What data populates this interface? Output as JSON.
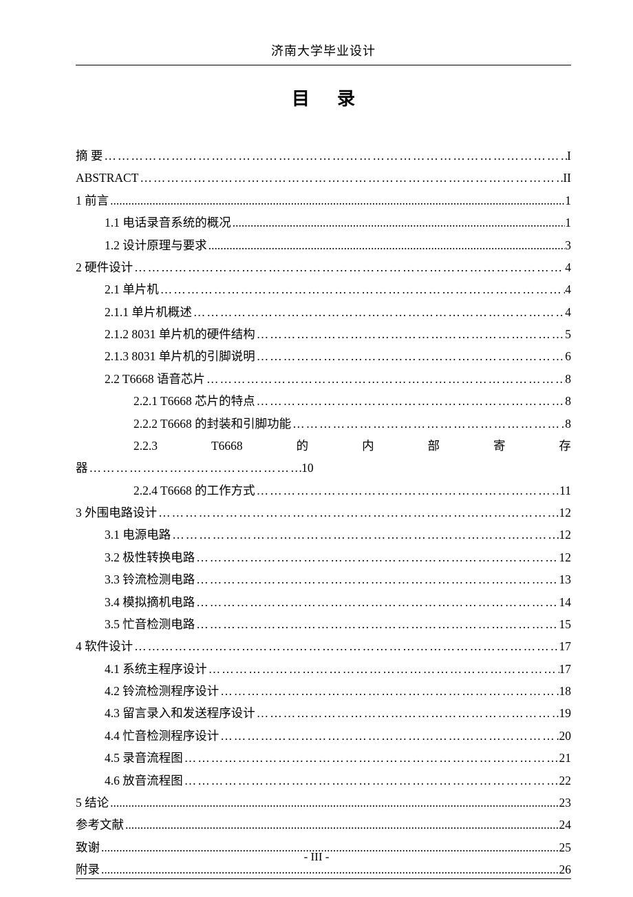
{
  "header": "济南大学毕业设计",
  "title_left": "目",
  "title_right": "录",
  "footer": "- III -",
  "toc": [
    {
      "label": "摘 要",
      "page": "I",
      "indent": 0
    },
    {
      "label": "ABSTRACT",
      "page": "II",
      "indent": 0
    },
    {
      "label": "1  前言",
      "page": "1",
      "indent": 0,
      "dotted": true
    },
    {
      "label": "1.1  电话录音系统的概况",
      "page": "1",
      "indent": 1,
      "dotted": true
    },
    {
      "label": "1.2  设计原理与要求",
      "page": "3",
      "indent": 1,
      "dotted": true
    },
    {
      "label": "2  硬件设计",
      "page": "4",
      "indent": 0
    },
    {
      "label": "2.1  单片机",
      "page": "4",
      "indent": 1
    },
    {
      "label": "2.1.1  单片机概述",
      "page": "4",
      "indent": 1
    },
    {
      "label": "2.1.2 8031 单片机的硬件结构",
      "page": "5",
      "indent": 1
    },
    {
      "label": "2.1.3 8031 单片机的引脚说明",
      "page": "6",
      "indent": 1
    },
    {
      "label": "2.2 T6668 语音芯片",
      "page": "8",
      "indent": 1
    },
    {
      "label": "2.2.1 T6668 芯片的特点",
      "page": "8",
      "indent": 2
    },
    {
      "label": "2.2.2 T6668 的封装和引脚功能",
      "page": "8",
      "indent": 2
    },
    {
      "special": "223",
      "tokens": [
        "2.2.3",
        "T6668",
        "的",
        "内",
        "部",
        "寄",
        "存"
      ],
      "line2_label": "器",
      "line2_page": "10"
    },
    {
      "label": "2.2.4 T6668 的工作方式",
      "page": "11",
      "indent": 2
    },
    {
      "label": "3  外围电路设计",
      "page": "12",
      "indent": 0
    },
    {
      "label": "3.1  电源电路",
      "page": "12",
      "indent": 1
    },
    {
      "label": "3.2  极性转换电路",
      "page": "12",
      "indent": 1
    },
    {
      "label": "3.3  铃流检测电路",
      "page": "13",
      "indent": 1
    },
    {
      "label": "3.4  模拟摘机电路",
      "page": "14",
      "indent": 1
    },
    {
      "label": "3.5  忙音检测电路",
      "page": "15",
      "indent": 1
    },
    {
      "label": "4  软件设计",
      "page": "17",
      "indent": 0
    },
    {
      "label": "4.1  系统主程序设计",
      "page": "17",
      "indent": 1
    },
    {
      "label": "4.2  铃流检测程序设计",
      "page": "18",
      "indent": 1
    },
    {
      "label": "4.3  留言录入和发送程序设计",
      "page": "19",
      "indent": 1
    },
    {
      "label": "4.4  忙音检测程序设计",
      "page": "20",
      "indent": 1
    },
    {
      "label": "4.5  录音流程图",
      "page": "21",
      "indent": 1
    },
    {
      "label": "4.6  放音流程图",
      "page": "22",
      "indent": 1
    },
    {
      "label": "5  结论",
      "page": "23",
      "indent": 0,
      "dotted": true
    },
    {
      "label": "参考文献",
      "page": "24",
      "indent": 0,
      "dotted": true
    },
    {
      "label": "致谢",
      "page": "25",
      "indent": 0,
      "dotted": true
    },
    {
      "label": "附录",
      "page": "26",
      "indent": 0,
      "dotted": true,
      "underline": true
    }
  ]
}
